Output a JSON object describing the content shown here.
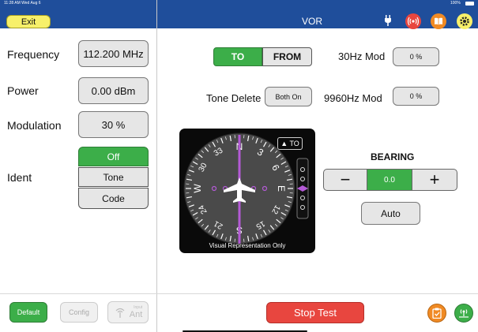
{
  "status_bar": {
    "time": "11:28 AM  Wed Aug 6",
    "battery": "100%"
  },
  "header": {
    "exit_label": "Exit",
    "title": "VOR"
  },
  "left": {
    "frequency": {
      "label": "Frequency",
      "value": "112.200 MHz"
    },
    "power": {
      "label": "Power",
      "value": "0.00 dBm"
    },
    "modulation": {
      "label": "Modulation",
      "value": "30 %"
    },
    "ident": {
      "label": "Ident",
      "options": [
        "Off",
        "Tone",
        "Code"
      ],
      "selected": "Off"
    }
  },
  "main": {
    "to_label": "TO",
    "from_label": "FROM",
    "mod30": {
      "label": "30Hz Mod",
      "value": "0 %"
    },
    "tone_delete": {
      "label": "Tone Delete",
      "value": "Both On"
    },
    "mod9960": {
      "label": "9960Hz Mod",
      "value": "0 %"
    },
    "indicator": {
      "to_flag": "▲ TO",
      "caption": "Visual Representation Only",
      "compass_labels": [
        "N",
        "3",
        "6",
        "E",
        "12",
        "15",
        "S",
        "21",
        "24",
        "W",
        "30",
        "33"
      ]
    },
    "bearing": {
      "label": "BEARING",
      "value": "0.0",
      "minus": "−",
      "plus": "+",
      "auto": "Auto"
    }
  },
  "footer": {
    "default_label": "Default",
    "config_label": "Config",
    "ant_small": "Input",
    "ant_label": "Ant",
    "stop_label": "Stop Test"
  },
  "colors": {
    "header": "#1f4e9b",
    "green": "#3cae49",
    "red": "#e8463f",
    "exit": "#f7f06a",
    "orange": "#f08a24"
  }
}
